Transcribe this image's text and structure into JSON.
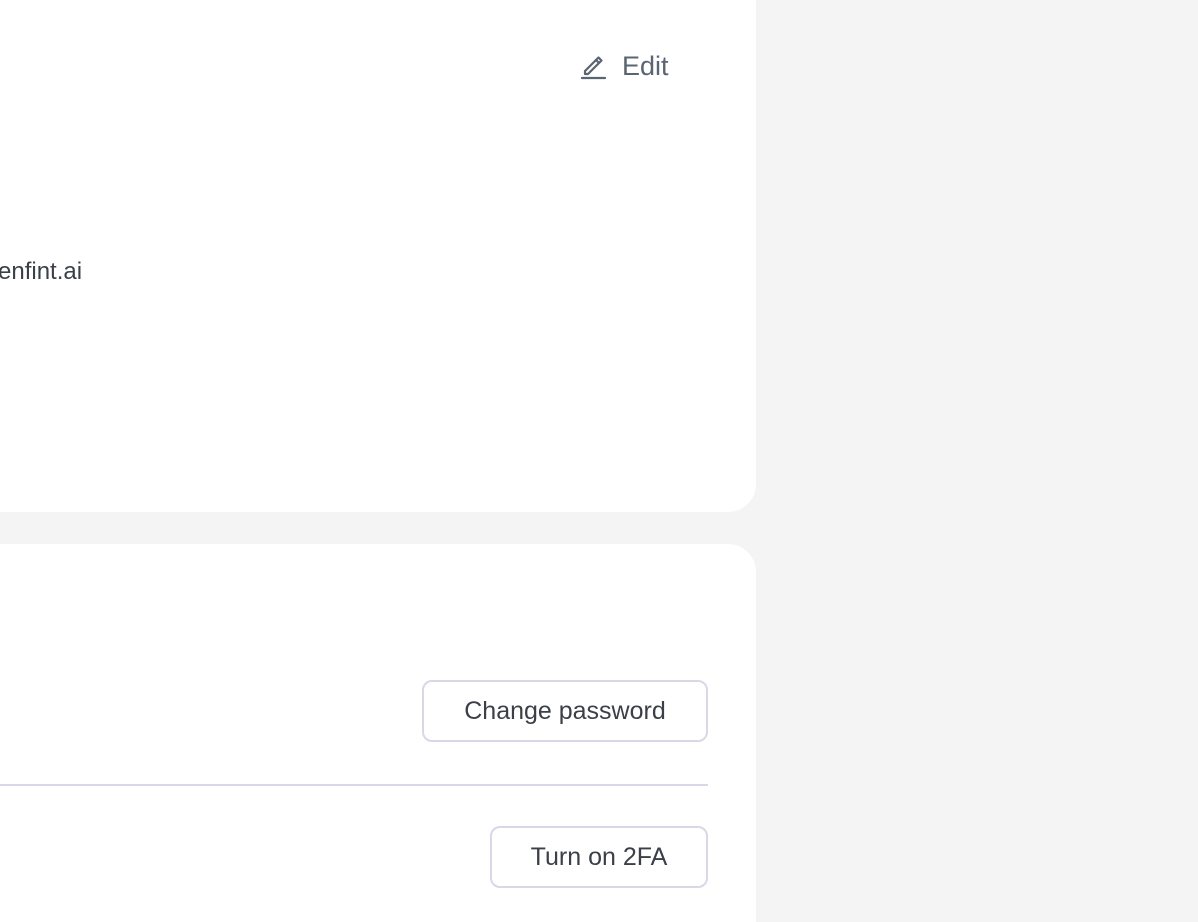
{
  "profile": {
    "edit_label": "Edit",
    "edit_icon": "pencil-icon",
    "email_fragment": "enfint.ai"
  },
  "security": {
    "change_password_label": "Change password",
    "twofa_label": "Turn on 2FA"
  },
  "colors": {
    "page_background": "#f4f4f4",
    "card_background": "#ffffff",
    "button_border": "#d8d8e8",
    "muted_text": "#5b6472",
    "body_text": "#3a3f48"
  }
}
